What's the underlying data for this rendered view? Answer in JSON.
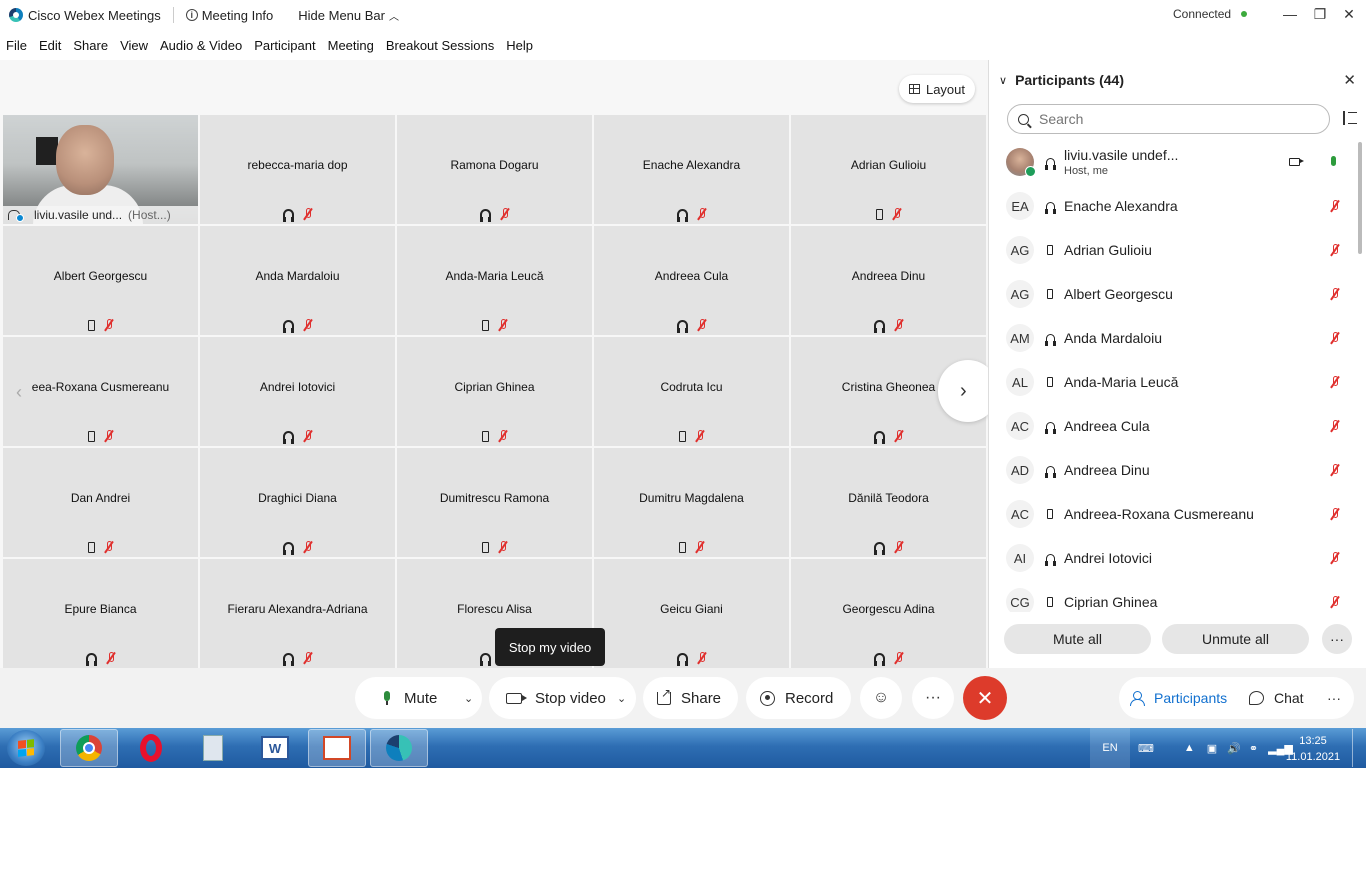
{
  "window": {
    "app_title": "Cisco Webex Meetings",
    "meeting_info": "Meeting Info",
    "hide_menu_bar": "Hide Menu Bar",
    "status": "Connected",
    "status_color": "#3caa3c"
  },
  "menu": [
    "File",
    "Edit",
    "Share",
    "View",
    "Audio & Video",
    "Participant",
    "Meeting",
    "Breakout Sessions",
    "Help"
  ],
  "layout_button": "Layout",
  "self_tile": {
    "name": "liviu.vasile und...",
    "role": "(Host...)"
  },
  "tiles": [
    {
      "name": "rebecca-maria dop",
      "device": "headset"
    },
    {
      "name": "Ramona Dogaru",
      "device": "headset"
    },
    {
      "name": "Enache Alexandra",
      "device": "headset"
    },
    {
      "name": "Adrian Gulioiu",
      "device": "phone"
    },
    {
      "name": "Albert Georgescu",
      "device": "phone"
    },
    {
      "name": "Anda Mardaloiu",
      "device": "headset"
    },
    {
      "name": "Anda-Maria Leucă",
      "device": "phone"
    },
    {
      "name": "Andreea Cula",
      "device": "headset"
    },
    {
      "name": "Andreea Dinu",
      "device": "headset"
    },
    {
      "name": "eea-Roxana Cusmereanu",
      "device": "phone"
    },
    {
      "name": "Andrei Iotovici",
      "device": "headset"
    },
    {
      "name": "Ciprian Ghinea",
      "device": "phone"
    },
    {
      "name": "Codruta Icu",
      "device": "phone"
    },
    {
      "name": "Cristina Gheonea",
      "device": "headset"
    },
    {
      "name": "Dan Andrei",
      "device": "phone"
    },
    {
      "name": "Draghici Diana",
      "device": "headset"
    },
    {
      "name": "Dumitrescu Ramona",
      "device": "phone"
    },
    {
      "name": "Dumitru Magdalena",
      "device": "phone"
    },
    {
      "name": "Dănilă Teodora",
      "device": "headset"
    },
    {
      "name": "Epure Bianca",
      "device": "headset"
    },
    {
      "name": "Fieraru Alexandra-Adriana",
      "device": "headset"
    },
    {
      "name": "Florescu Alisa",
      "device": "headset"
    },
    {
      "name": "Geicu Giani",
      "device": "headset"
    },
    {
      "name": "Georgescu Adina",
      "device": "headset"
    }
  ],
  "tooltip": "Stop my video",
  "controls": {
    "mute": "Mute",
    "stop_video": "Stop video",
    "share": "Share",
    "record": "Record",
    "more": "···",
    "end_call": "✕",
    "participants_tab": "Participants",
    "chat_tab": "Chat",
    "accent": "#1170cf",
    "end_color": "#dd3b2b"
  },
  "panel": {
    "title": "Participants (44)",
    "search_placeholder": "Search",
    "participants": [
      {
        "initials": "",
        "name": "liviu.vasile undef...",
        "sub": "Host, me",
        "device": "headset",
        "photo": true
      },
      {
        "initials": "EA",
        "name": "Enache Alexandra",
        "device": "headset"
      },
      {
        "initials": "AG",
        "name": "Adrian Gulioiu",
        "device": "phone"
      },
      {
        "initials": "AG",
        "name": "Albert Georgescu",
        "device": "phone"
      },
      {
        "initials": "AM",
        "name": "Anda Mardaloiu",
        "device": "headset"
      },
      {
        "initials": "AL",
        "name": "Anda-Maria Leucă",
        "device": "phone"
      },
      {
        "initials": "AC",
        "name": "Andreea Cula",
        "device": "headset"
      },
      {
        "initials": "AD",
        "name": "Andreea Dinu",
        "device": "headset"
      },
      {
        "initials": "AC",
        "name": "Andreea-Roxana Cusmereanu",
        "device": "phone"
      },
      {
        "initials": "AI",
        "name": "Andrei Iotovici",
        "device": "headset"
      },
      {
        "initials": "CG",
        "name": "Ciprian Ghinea",
        "device": "phone"
      }
    ],
    "mute_all": "Mute all",
    "unmute_all": "Unmute all",
    "more": "···"
  },
  "taskbar": {
    "apps": [
      "chrome-icon",
      "opera-icon",
      "calculator-icon",
      "word-icon",
      "powerpoint-icon",
      "webex-icon"
    ],
    "language": "EN",
    "time": "13:25",
    "date": "11.01.2021"
  }
}
